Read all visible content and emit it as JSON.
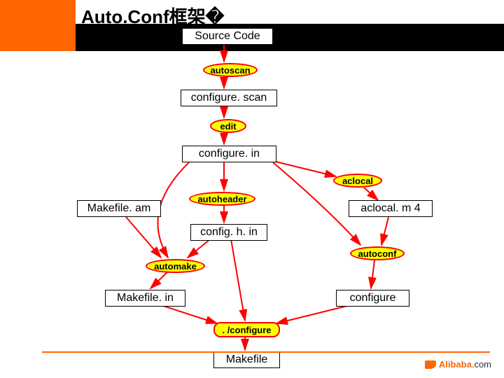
{
  "title": "Auto.Conf框架�",
  "brand": {
    "name": "Alibaba",
    "suffix": ".com"
  },
  "nodes": {
    "source_code": "Source Code",
    "configure_scan": "configure. scan",
    "configure_in": "configure. in",
    "makefile_am": "Makefile. am",
    "aclocal_m4": "aclocal. m 4",
    "config_h_in": "config. h. in",
    "makefile_in": "Makefile. in",
    "configure": "configure",
    "makefile": "Makefile"
  },
  "tools": {
    "autoscan": "autoscan",
    "edit": "edit",
    "aclocal": "aclocal",
    "autoheader": "autoheader",
    "automake": "automake",
    "autoconf": "autoconf",
    "run_configure": ". /configure"
  }
}
